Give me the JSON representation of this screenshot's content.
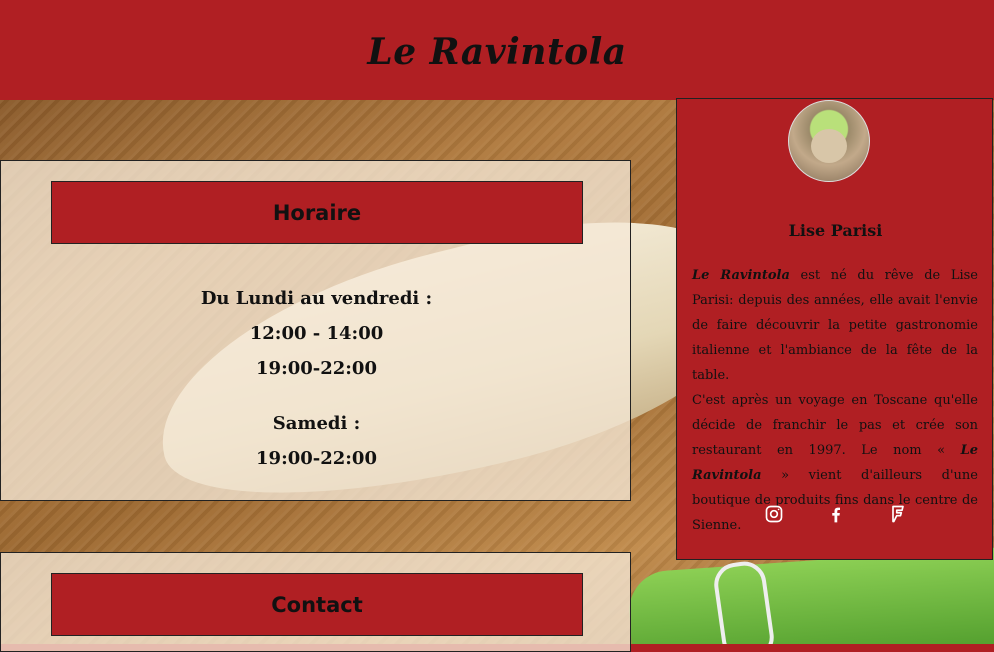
{
  "header": {
    "title": "Le Ravintola"
  },
  "hours": {
    "heading": "Horaire",
    "weekday_label": "Du Lundi au vendredi :",
    "weekday_lunch": "12:00 - 14:00",
    "weekday_dinner": "19:00-22:00",
    "saturday_label": "Samedi :",
    "saturday_dinner": "19:00-22:00"
  },
  "contact": {
    "heading": "Contact"
  },
  "sidebar": {
    "owner_name": "Lise Parisi",
    "bio_brand": "Le Ravintola",
    "bio_p1": " est né du rêve de Lise Parisi: depuis des années, elle avait l'envie de faire découvrir la petite gastronomie italienne et l'ambiance de la fête de la table.",
    "bio_p2a": "C'est après un voyage en Toscane qu'elle décide de franchir le pas et crée son restaurant en 1997. Le nom « ",
    "bio_p2b": " » vient d'ailleurs d'une boutique de produits fins dans le centre de Sienne.",
    "socials": [
      "instagram-icon",
      "facebook-icon",
      "foursquare-icon"
    ]
  },
  "colors": {
    "brand_red": "#b01f23",
    "panel_bg": "#f5e8d6"
  }
}
